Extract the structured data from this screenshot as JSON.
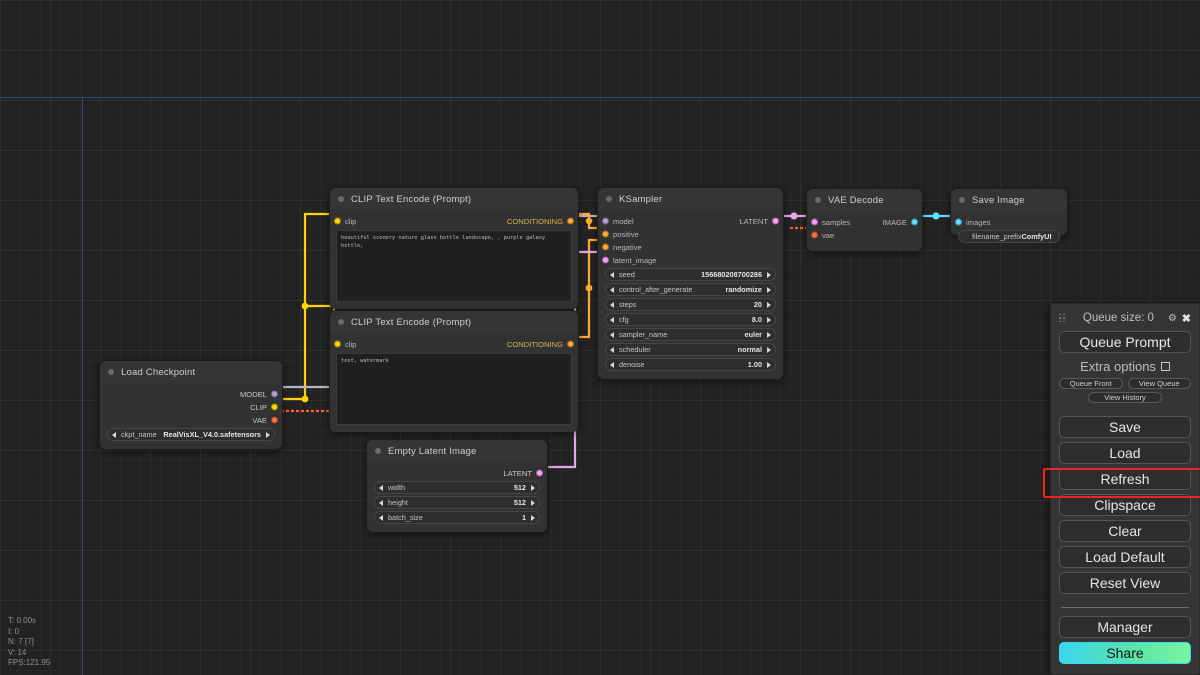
{
  "app": {
    "title": "ComfyUI"
  },
  "canvas": {
    "background_color": "#222222",
    "guide_color": "#2f4a6e"
  },
  "nodes": {
    "load_checkpoint": {
      "title": "Load Checkpoint",
      "outputs": [
        {
          "label": "MODEL",
          "color": "#b39ddb"
        },
        {
          "label": "CLIP",
          "color": "#ffd500"
        },
        {
          "label": "VAE",
          "color": "#ff6e40"
        }
      ],
      "widgets": [
        {
          "label": "ckpt_name",
          "value": "RealVisXL_V4.0.safetensors"
        }
      ]
    },
    "clip_positive": {
      "title": "CLIP Text Encode (Prompt)",
      "input": {
        "label": "clip",
        "color": "#ffd500"
      },
      "output": {
        "label": "CONDITIONING",
        "color": "#ffa931"
      },
      "text": "beautiful scenery nature glass bottle landscape, , purple galaxy bottle,"
    },
    "clip_negative": {
      "title": "CLIP Text Encode (Prompt)",
      "input": {
        "label": "clip",
        "color": "#ffd500"
      },
      "output": {
        "label": "CONDITIONING",
        "color": "#ffa931"
      },
      "text": "text, watermark"
    },
    "ksampler": {
      "title": "KSampler",
      "inputs": [
        {
          "label": "model",
          "color": "#b39ddb"
        },
        {
          "label": "positive",
          "color": "#ffa931"
        },
        {
          "label": "negative",
          "color": "#ffa931"
        },
        {
          "label": "latent_image",
          "color": "#ff9cf9"
        }
      ],
      "outputs": [
        {
          "label": "LATENT",
          "color": "#ff9cf9"
        }
      ],
      "widgets": [
        {
          "label": "seed",
          "value": "156680208700286"
        },
        {
          "label": "control_after_generate",
          "value": "randomize"
        },
        {
          "label": "steps",
          "value": "20"
        },
        {
          "label": "cfg",
          "value": "8.0"
        },
        {
          "label": "sampler_name",
          "value": "euler"
        },
        {
          "label": "scheduler",
          "value": "normal"
        },
        {
          "label": "denoise",
          "value": "1.00"
        }
      ]
    },
    "empty_latent": {
      "title": "Empty Latent Image",
      "outputs": [
        {
          "label": "LATENT",
          "color": "#ff9cf9"
        }
      ],
      "widgets": [
        {
          "label": "width",
          "value": "512"
        },
        {
          "label": "height",
          "value": "512"
        },
        {
          "label": "batch_size",
          "value": "1"
        }
      ]
    },
    "vae_decode": {
      "title": "VAE Decode",
      "inputs": [
        {
          "label": "samples",
          "color": "#ff9cf9"
        },
        {
          "label": "vae",
          "color": "#ff6e40"
        }
      ],
      "outputs": [
        {
          "label": "IMAGE",
          "color": "#64e1ff"
        }
      ]
    },
    "save_image": {
      "title": "Save Image",
      "inputs": [
        {
          "label": "images",
          "color": "#64e1ff"
        }
      ],
      "widgets": [
        {
          "label": "filename_prefix",
          "value": "ComfyUI"
        }
      ]
    }
  },
  "menu": {
    "queue_size_label": "Queue size: 0",
    "gear_icon": "gear-icon",
    "close_icon": "close-icon",
    "queue_prompt": "Queue Prompt",
    "extra_options": "Extra options",
    "queue_front": "Queue Front",
    "view_queue": "View Queue",
    "view_history": "View History",
    "save": "Save",
    "load": "Load",
    "refresh": "Refresh",
    "clipspace": "Clipspace",
    "clear": "Clear",
    "load_default": "Load Default",
    "reset_view": "Reset View",
    "manager": "Manager",
    "share": "Share",
    "highlight_color": "#f02323",
    "highlighted_item": "Refresh"
  },
  "stats": {
    "time": "T: 0.00s",
    "iterations": "I: 0",
    "nodes": "N: 7 [7]",
    "vertices": "V: 14",
    "fps": "FPS:121.95"
  }
}
